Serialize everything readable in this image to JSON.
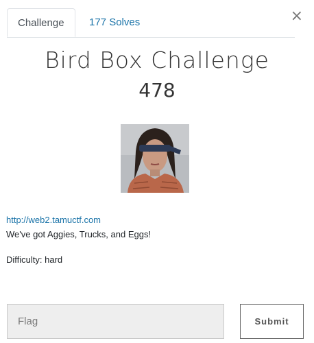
{
  "tabs": {
    "challenge_label": "Challenge",
    "solves_label": "177 Solves"
  },
  "close_label": "×",
  "challenge": {
    "name": "Bird Box Challenge",
    "points": "478",
    "image_icon": "blindfolded-person-photo",
    "link": "http://web2.tamuctf.com",
    "description": "We've got Aggies, Trucks, and Eggs!",
    "difficulty": "Difficulty: hard"
  },
  "form": {
    "flag_placeholder": "Flag",
    "submit_label": "Submit"
  },
  "colors": {
    "link": "#1a73a8",
    "input_bg": "#eeeeee"
  }
}
